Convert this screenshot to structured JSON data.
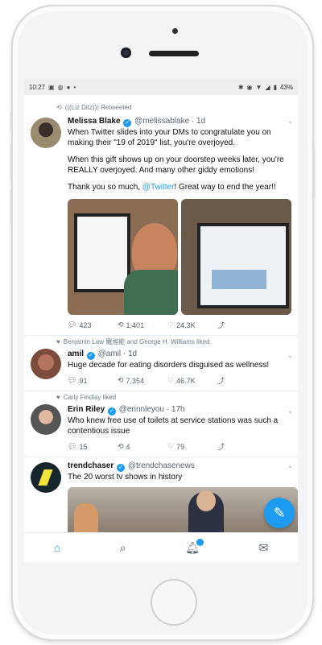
{
  "status_bar": {
    "time": "10:27",
    "left_icons": [
      "message-icon",
      "whatsapp-icon",
      "facebook-icon",
      "dot-icon"
    ],
    "right_icons": [
      "bluetooth-icon",
      "eye-icon",
      "wifi-icon",
      "signal-icon",
      "battery-icon"
    ],
    "battery": "43%"
  },
  "tweets": [
    {
      "context": "(((Liz Ditz))) Retweeted",
      "name": "Melissa Blake",
      "handle": "@melissablake",
      "time": "1d",
      "text1": "When Twitter slides into your DMs to congratulate you on making their \"19 of 2019\" list, you're overjoyed.",
      "text2": "When this gift shows up on your doorstep weeks later, you're REALLY overjoyed. And many other giddy emotions!",
      "text3a": "Thank you so much, ",
      "text3link": "@Twitter",
      "text3b": "! Great way to end the year!!",
      "replies": "423",
      "retweets": "1,401",
      "likes": "24.3K"
    },
    {
      "context": "Benjamin Law 羅旭能 and George H. Williams liked",
      "name": "amil",
      "handle": "@amil",
      "time": "1d",
      "text": "Huge decade for eating disorders disguised as wellness!",
      "replies": "91",
      "retweets": "7,354",
      "likes": "46.7K"
    },
    {
      "context": "Carly Findlay liked",
      "name": "Erin Riley",
      "handle": "@erinnleyou",
      "time": "17h",
      "text": "Who knew free use of toilets at service stations was such a contentious issue",
      "replies": "15",
      "retweets": "4",
      "likes": "79"
    },
    {
      "name": "trendchaser",
      "handle": "@trendchasenews",
      "text": "The 20 worst tv shows in history"
    }
  ],
  "tabbar": {
    "items": [
      "home-icon",
      "search-icon",
      "notifications-icon",
      "messages-icon"
    ]
  },
  "colors": {
    "accent": "#1d9bf0"
  }
}
